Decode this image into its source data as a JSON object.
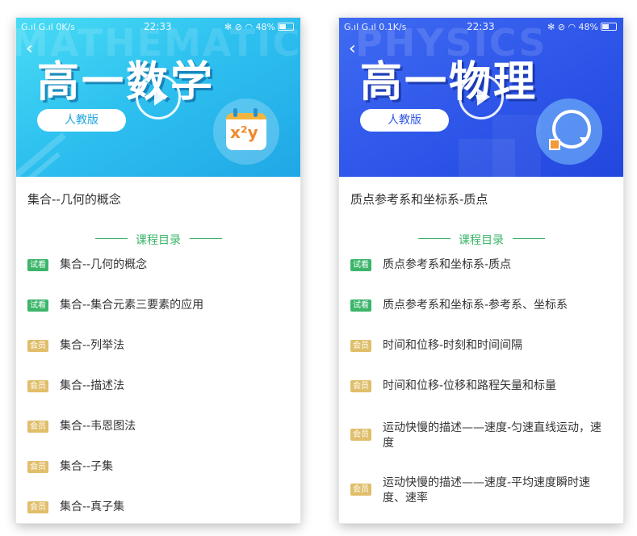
{
  "left": {
    "status": {
      "carrier": "G.ıl G.ıl 0K/s",
      "time": "22:33",
      "right": "✻ ⊘ ◠ 48%"
    },
    "watermark": "MATHEMATICS",
    "title": "高一数学",
    "edition": "人教版",
    "icon_formula": "x²y",
    "lesson_title": "集合--几何的概念",
    "catalog_label": "课程目录",
    "items": [
      {
        "badge": "试看",
        "label": "集合--几何的概念"
      },
      {
        "badge": "试看",
        "label": "集合--集合元素三要素的应用"
      },
      {
        "badge": "会员",
        "label": "集合--列举法"
      },
      {
        "badge": "会员",
        "label": "集合--描述法"
      },
      {
        "badge": "会员",
        "label": "集合--韦恩图法"
      },
      {
        "badge": "会员",
        "label": "集合--子集"
      },
      {
        "badge": "会员",
        "label": "集合--真子集"
      }
    ]
  },
  "right": {
    "status": {
      "carrier": "G.ıl G.ıl 0.1K/s",
      "time": "22:33",
      "right": "✻ ⊘ ◠ 48%"
    },
    "watermark": "PHYSICS",
    "title": "高一物理",
    "edition": "人教版",
    "lesson_title": "质点参考系和坐标系-质点",
    "catalog_label": "课程目录",
    "items": [
      {
        "badge": "试看",
        "label": "质点参考系和坐标系-质点"
      },
      {
        "badge": "试看",
        "label": "质点参考系和坐标系-参考系、坐标系"
      },
      {
        "badge": "会员",
        "label": "时间和位移-时刻和时间间隔"
      },
      {
        "badge": "会员",
        "label": "时间和位移-位移和路程矢量和标量"
      },
      {
        "badge": "会员",
        "label": "运动快慢的描述——速度-匀速直线运动，速度"
      },
      {
        "badge": "会员",
        "label": "运动快慢的描述——速度-平均速度瞬时速度、速率"
      }
    ]
  },
  "colors": {
    "math_banner": "#2ec1ef",
    "physics_banner": "#2f57ea",
    "trial_badge": "#3bb56a",
    "member_badge": "#e0be6a",
    "accent_green": "#3bb56a"
  }
}
